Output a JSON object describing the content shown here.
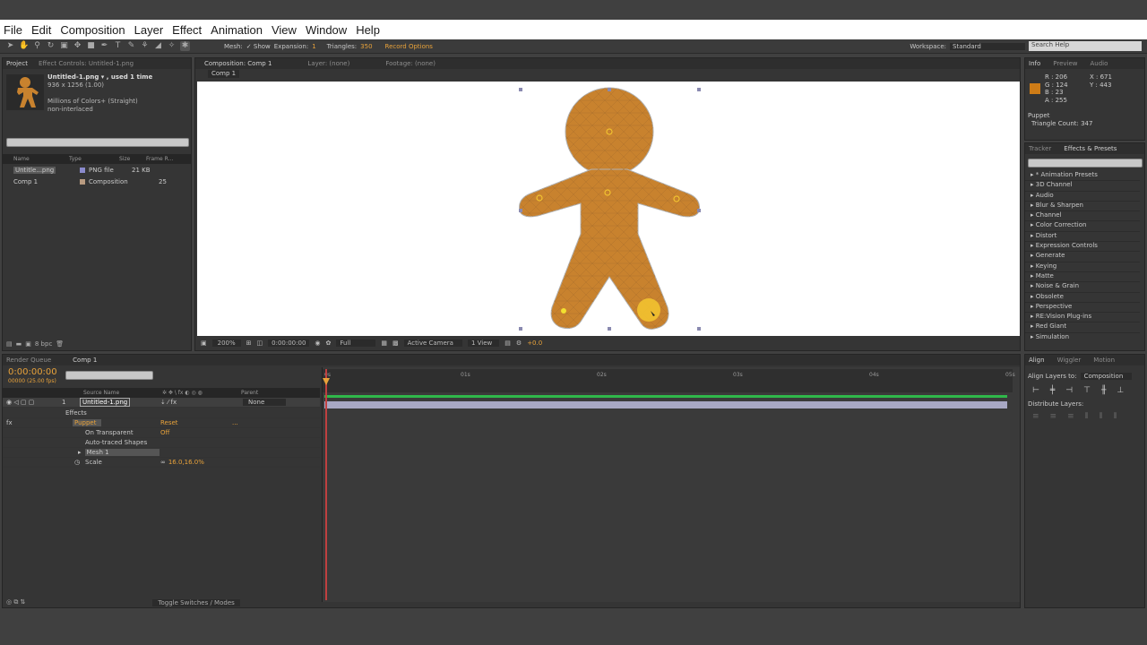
{
  "menu": [
    "File",
    "Edit",
    "Composition",
    "Layer",
    "Effect",
    "Animation",
    "View",
    "Window",
    "Help"
  ],
  "toolbar": {
    "mesh_label": "Mesh:",
    "show_label": "✓ Show",
    "expansion_label": "Expansion:",
    "expansion_value": "1",
    "triangles_label": "Triangles:",
    "triangles_value": "350",
    "record_options": "Record Options",
    "workspace_label": "Workspace:",
    "workspace_value": "Standard",
    "search_help": "Search Help"
  },
  "project": {
    "tabs": [
      "Project",
      "Effect Controls: Untitled-1.png"
    ],
    "file_name": "Untitled-1.png ▾ , used 1 time",
    "dimensions": "936 x 1256 (1.00)",
    "colors": "Millions of Colors+ (Straight)",
    "interlace": "non-interlaced",
    "columns": [
      "Name",
      "Type",
      "Size",
      "Frame R..."
    ],
    "items": [
      {
        "name": "Untitle...png",
        "type": "PNG file",
        "size": "21 KB",
        "frame": ""
      },
      {
        "name": "Comp 1",
        "type": "Composition",
        "size": "",
        "frame": "25"
      }
    ],
    "bpc": "8 bpc"
  },
  "viewer": {
    "tabs": [
      "Composition: Comp 1",
      "Layer: (none)",
      "Footage: (none)"
    ],
    "comp_chip": "Comp 1",
    "zoom": "200%",
    "timecode": "0:00:00:00",
    "resolution": "Full",
    "camera": "Active Camera",
    "view": "1 View",
    "exposure": "+0.0"
  },
  "info": {
    "tabs": [
      "Info",
      "Preview",
      "Audio"
    ],
    "r": "R : 206",
    "g": "G : 124",
    "b": "B : 23",
    "a": "A : 255",
    "x": "X : 671",
    "y": "Y : 443",
    "swatch_color": "#ce7c17",
    "tool": "Puppet",
    "triangle_count": "Triangle Count: 347"
  },
  "effects": {
    "tabs": [
      "Tracker",
      "Effects & Presets"
    ],
    "items": [
      "* Animation Presets",
      "3D Channel",
      "Audio",
      "Blur & Sharpen",
      "Channel",
      "Color Correction",
      "Distort",
      "Expression Controls",
      "Generate",
      "Keying",
      "Matte",
      "Noise & Grain",
      "Obsolete",
      "Perspective",
      "RE:Vision Plug-ins",
      "Red Giant",
      "Simulation"
    ]
  },
  "timeline": {
    "tabs": [
      "Render Queue",
      "Comp 1"
    ],
    "timecode": "0:00:00:00",
    "fps": "00000 (25.00 fps)",
    "col_source": "Source Name",
    "col_parent": "Parent",
    "layer_num": "1",
    "layer_name": "Untitled-1.png",
    "parent_value": "None",
    "effects_label": "Effects",
    "puppet_label": "Puppet",
    "reset_label": "Reset",
    "dots": "...",
    "on_transparent": "On Transparent",
    "on_transparent_value": "Off",
    "auto_traced": "Auto-traced Shapes",
    "mesh1": "Mesh 1",
    "scale": "Scale",
    "scale_value": "16.0,16.0%",
    "ruler": [
      "0s",
      "01s",
      "02s",
      "03s",
      "04s",
      "05s"
    ],
    "toggle": "Toggle Switches / Modes"
  },
  "align": {
    "tabs": [
      "Align",
      "Wiggler",
      "Motion"
    ],
    "align_to_label": "Align Layers to:",
    "align_to_value": "Composition",
    "distribute_label": "Distribute Layers:"
  },
  "colors": {
    "gingerbread": "#c8822e",
    "pin": "#f2c230",
    "accent": "#e8a23a"
  }
}
